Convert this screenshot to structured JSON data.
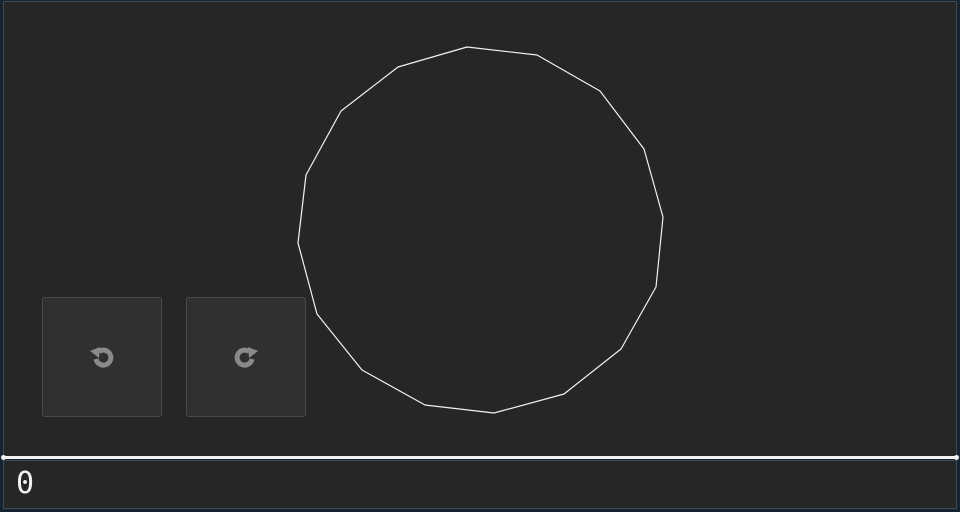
{
  "game": {
    "score": "0",
    "colors": {
      "background": "#262626",
      "ball_outline": "#f2f2f2",
      "button_fill": "#303030",
      "button_icon": "#8a8a8a",
      "frame": "#17232f"
    }
  },
  "controls": {
    "rotate_left": {
      "icon": "rotate-counterclockwise-icon"
    },
    "rotate_right": {
      "icon": "rotate-clockwise-icon"
    }
  }
}
